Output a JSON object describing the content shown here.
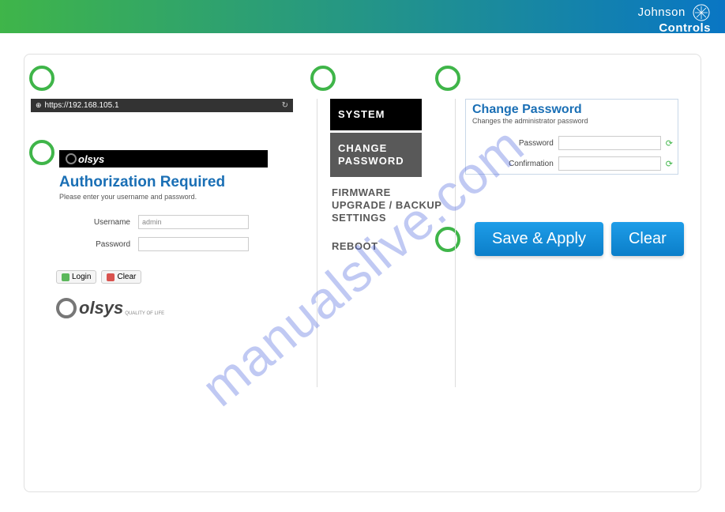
{
  "header": {
    "brand_top": "Johnson",
    "brand_bottom": "Controls"
  },
  "watermark": "manualslive.com",
  "col1": {
    "url": "https://192.168.105.1",
    "brand": "olsys",
    "auth_title": "Authorization Required",
    "auth_sub": "Please enter your username and password.",
    "username_label": "Username",
    "username_value": "admin",
    "password_label": "Password",
    "login_btn": "Login",
    "clear_btn": "Clear",
    "footer_brand": "olsys",
    "footer_tag": "QUALITY OF LIFE"
  },
  "col2": {
    "system": "SYSTEM",
    "change_password": "CHANGE PASSWORD",
    "firmware": "FIRMWARE UPGRADE / BACKUP SETTINGS",
    "reboot": "REBOOT"
  },
  "col3": {
    "title": "Change Password",
    "sub": "Changes the administrator password",
    "password_label": "Password",
    "confirmation_label": "Confirmation",
    "save_btn": "Save & Apply",
    "clear_btn": "Clear"
  }
}
